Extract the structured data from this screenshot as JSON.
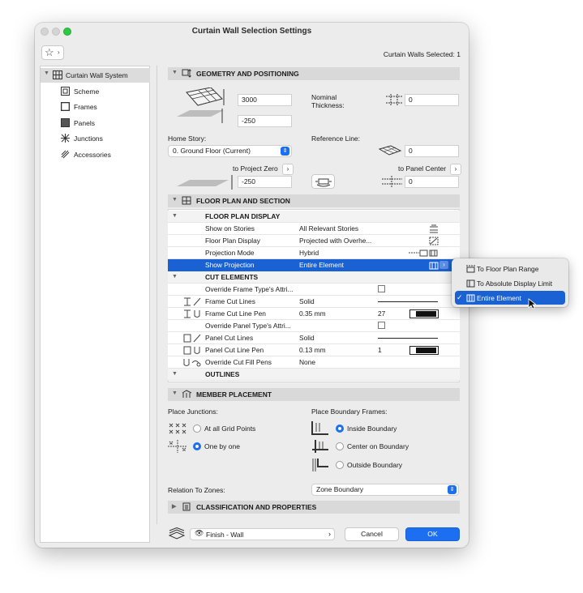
{
  "window": {
    "title": "Curtain Wall Selection Settings"
  },
  "header": {
    "selected_count": "Curtain Walls Selected: 1"
  },
  "tree": {
    "root": "Curtain Wall System",
    "items": [
      "Scheme",
      "Frames",
      "Panels",
      "Junctions",
      "Accessories"
    ]
  },
  "geometry": {
    "title": "GEOMETRY AND POSITIONING",
    "height_value": "3000",
    "offset_value": "-250",
    "nominal_thickness_label": "Nominal\nThickness:",
    "thickness_value": "0",
    "home_story_label": "Home Story:",
    "home_story_value": "0. Ground Floor (Current)",
    "reference_line_label": "Reference Line:",
    "reference_value": "0",
    "to_project_zero": "to Project Zero",
    "project_zero_value": "-250",
    "to_panel_center": "to Panel Center",
    "panel_center_value": "0"
  },
  "floor_plan": {
    "title": "FLOOR PLAN AND SECTION",
    "display_header": "FLOOR PLAN DISPLAY",
    "rows": [
      {
        "name": "Show on Stories",
        "value": "All Relevant Stories"
      },
      {
        "name": "Floor Plan Display",
        "value": "Projected with Overhe..."
      },
      {
        "name": "Projection Mode",
        "value": "Hybrid"
      },
      {
        "name": "Show Projection",
        "value": "Entire Element"
      }
    ],
    "cut_header": "CUT ELEMENTS",
    "cut_rows": [
      {
        "name": "Override Frame Type's Attri...",
        "value": ""
      },
      {
        "name": "Frame Cut Lines",
        "value": "Solid"
      },
      {
        "name": "Frame Cut Line Pen",
        "value": "0.35 mm",
        "pen": "27"
      },
      {
        "name": "Override Panel Type's Attri...",
        "value": ""
      },
      {
        "name": "Panel Cut Lines",
        "value": "Solid"
      },
      {
        "name": "Panel Cut Line Pen",
        "value": "0.13 mm",
        "pen": "1"
      },
      {
        "name": "Override Cut Fill Pens",
        "value": "None"
      }
    ],
    "outlines_header": "OUTLINES"
  },
  "member_placement": {
    "title": "MEMBER PLACEMENT",
    "junctions_label": "Place Junctions:",
    "junction_options": [
      "At all Grid Points",
      "One by one"
    ],
    "junction_selected": 1,
    "boundary_label": "Place Boundary Frames:",
    "boundary_options": [
      "Inside Boundary",
      "Center on Boundary",
      "Outside Boundary"
    ],
    "boundary_selected": 0,
    "zones_label": "Relation To Zones:",
    "zones_value": "Zone Boundary"
  },
  "classification": {
    "title": "CLASSIFICATION AND PROPERTIES"
  },
  "footer": {
    "layer_value": "Finish - Wall",
    "cancel_label": "Cancel",
    "ok_label": "OK"
  },
  "projection_menu": {
    "items": [
      "To Floor Plan Range",
      "To Absolute Display Limit",
      "Entire Element"
    ],
    "selected": 2,
    "check": "✓"
  },
  "colors": {
    "accent": "#1d6ff2",
    "highlight": "#1a62d4",
    "section_bg": "#d9d9d9"
  }
}
